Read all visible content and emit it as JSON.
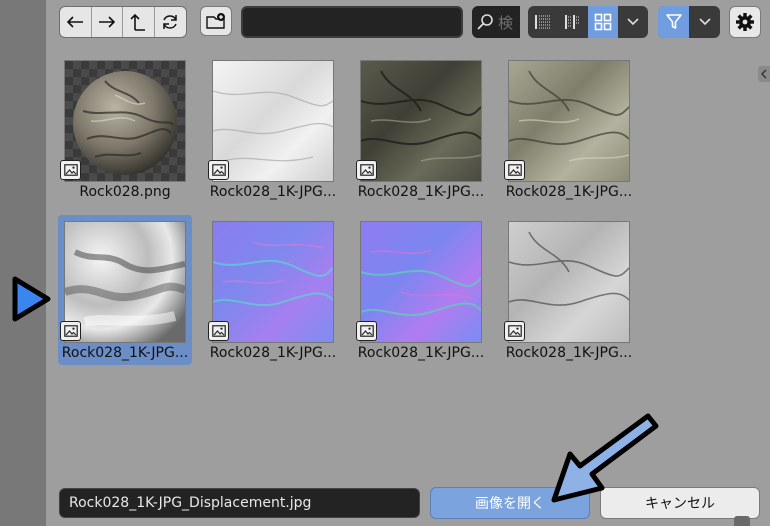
{
  "toolbar": {
    "search_placeholder": "検",
    "path_value": "",
    "icons": {
      "back": "arrow-left-icon",
      "forward": "arrow-right-icon",
      "parent": "arrow-up-icon",
      "refresh": "refresh-icon",
      "new_directory": "new-folder-icon",
      "search": "search-icon",
      "view_list_vertical": "list-vertical-icon",
      "view_list_horizontal": "list-horizontal-icon",
      "view_thumbnails": "thumbnails-icon",
      "view_options": "chevron-down-icon",
      "filter": "filter-icon",
      "filter_options": "chevron-down-icon",
      "settings": "gear-icon"
    },
    "active_view": "thumbnails",
    "filter_active": true
  },
  "files": [
    {
      "label": "Rock028.png",
      "selected": false,
      "preview": "sphere"
    },
    {
      "label": "Rock028_1K-JPG...",
      "selected": false,
      "preview": "white"
    },
    {
      "label": "Rock028_1K-JPG...",
      "selected": false,
      "preview": "dark"
    },
    {
      "label": "Rock028_1K-JPG...",
      "selected": false,
      "preview": "olive"
    },
    {
      "label": "Rock028_1K-JPG...",
      "selected": true,
      "preview": "displacement"
    },
    {
      "label": "Rock028_1K-JPG...",
      "selected": false,
      "preview": "normal-a"
    },
    {
      "label": "Rock028_1K-JPG...",
      "selected": false,
      "preview": "normal-b"
    },
    {
      "label": "Rock028_1K-JPG...",
      "selected": false,
      "preview": "roughness"
    }
  ],
  "footer": {
    "filename": "Rock028_1K-JPG_Displacement.jpg",
    "open_label": "画像を開く",
    "cancel_label": "キャンセル"
  },
  "colors": {
    "accent": "#6f9de0",
    "selection": "#6b8ec7",
    "annotation_arrow": "#8fb2e6"
  }
}
